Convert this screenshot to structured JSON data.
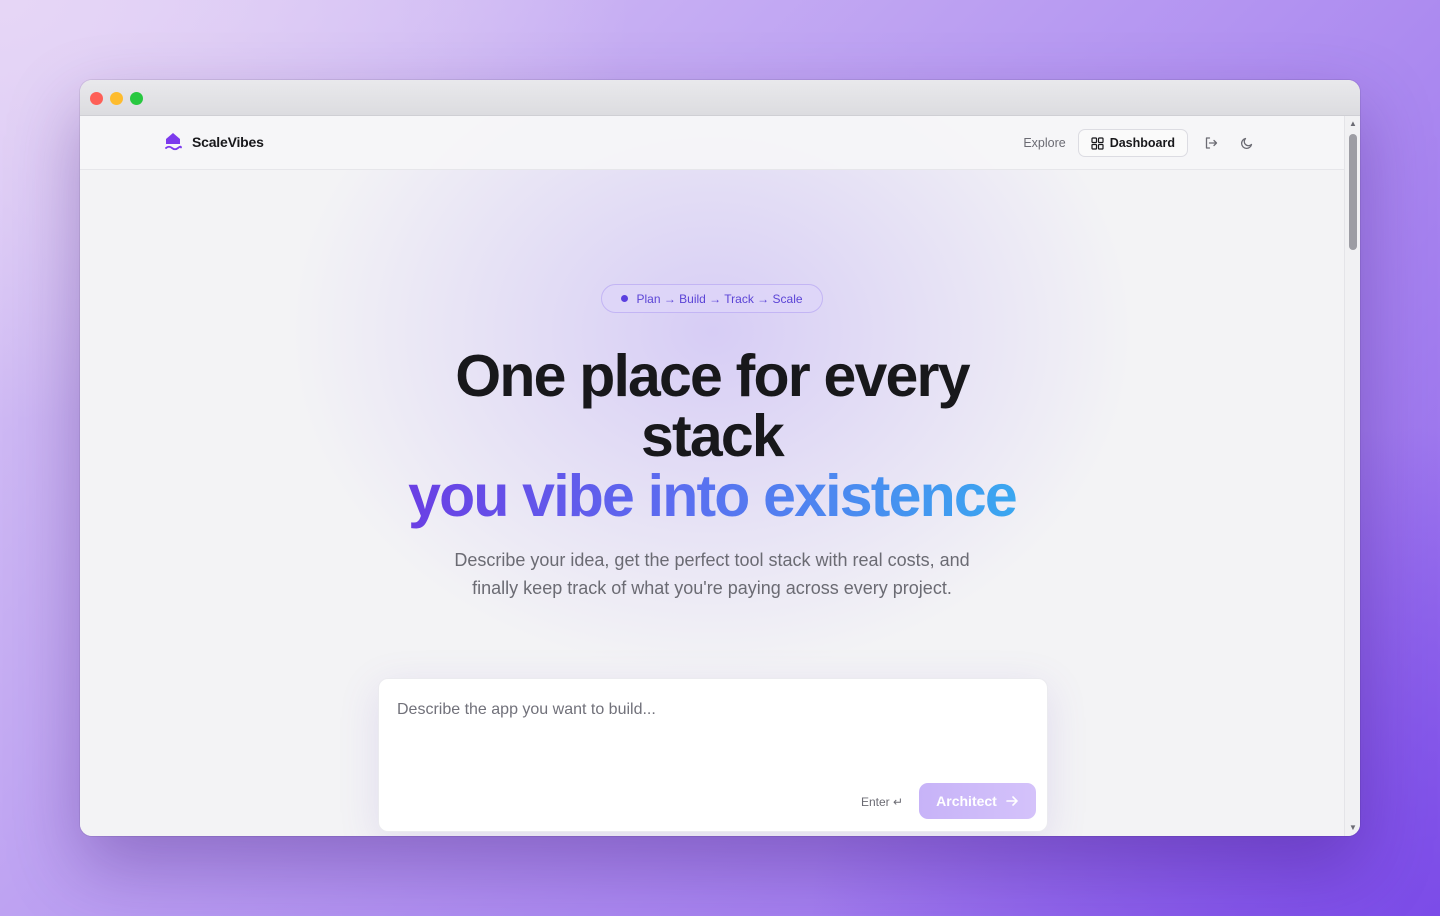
{
  "brand": {
    "name": "ScaleVibes",
    "icon": "house-wave-icon"
  },
  "nav": {
    "explore_label": "Explore",
    "dashboard_label": "Dashboard",
    "logout_icon": "logout-icon",
    "theme_icon": "moon-icon"
  },
  "hero": {
    "pill_text": "Plan → Build → Track → Scale",
    "headline_line1": "One place for every",
    "headline_line2": "stack",
    "headline_line3": "you vibe into existence",
    "subheadline": "Describe your idea, get the perfect tool stack with real costs, and finally keep track of what you're paying across every project."
  },
  "composer": {
    "placeholder": "Describe the app you want to build...",
    "value": "",
    "enter_hint": "Enter ↵",
    "submit_label": "Architect"
  },
  "colors": {
    "accent": "#6a3fe4",
    "gradient_end": "#3aa7f0",
    "button_bg": "#c7b3f8"
  }
}
